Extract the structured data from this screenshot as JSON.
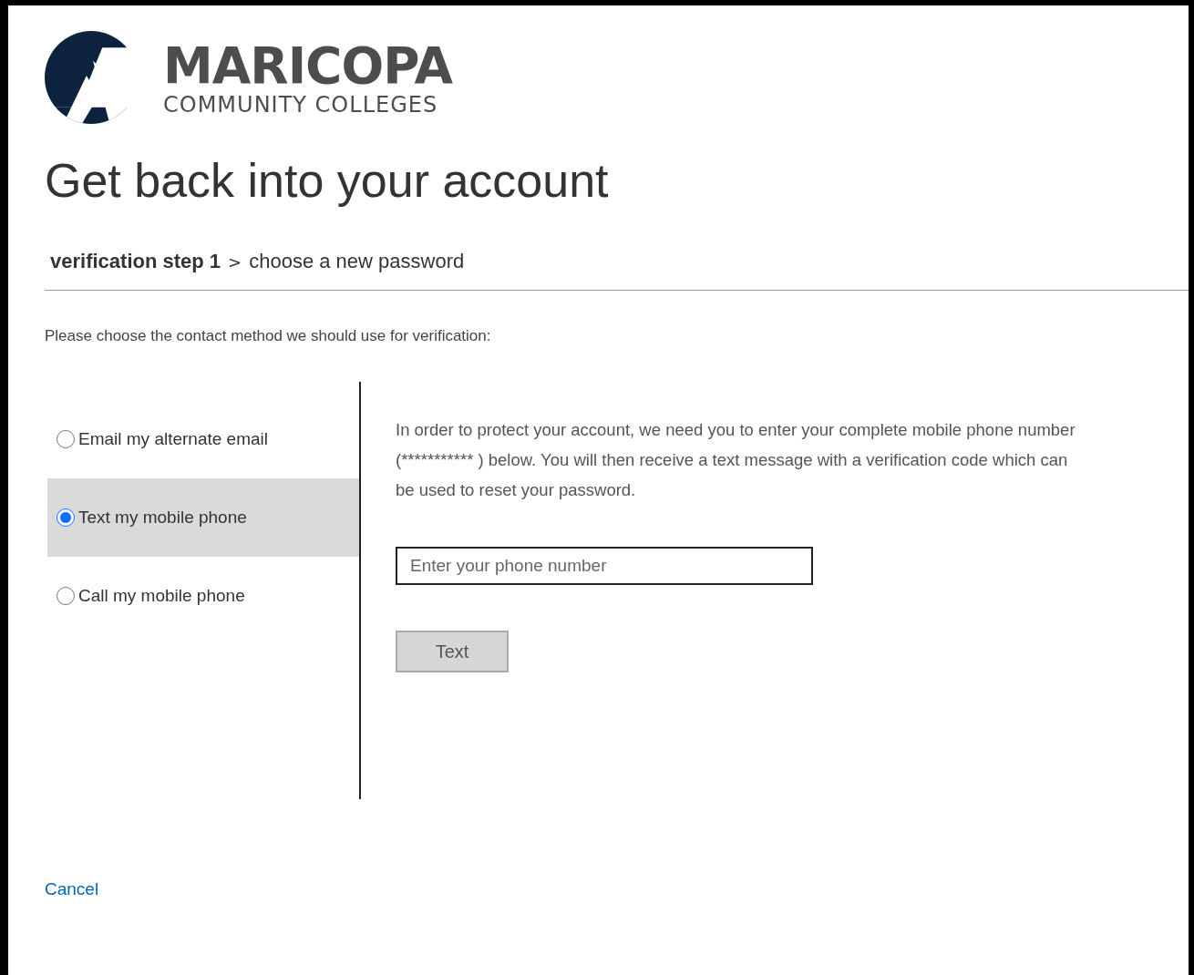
{
  "logo": {
    "name": "MARICOPA",
    "subtitle": "COMMUNITY COLLEGES"
  },
  "title": "Get back into your account",
  "steps": [
    {
      "label": "verification step 1",
      "selected": true
    },
    {
      "label": "choose a new password",
      "selected": false
    }
  ],
  "step_separator": ">",
  "instruction": "Please choose the contact method we should use for verification:",
  "methods": [
    {
      "label": "Email my alternate email",
      "selected": false
    },
    {
      "label": "Text my mobile phone",
      "selected": true
    },
    {
      "label": "Call my mobile phone",
      "selected": false
    }
  ],
  "description": "In order to protect your account, we need you to enter your complete mobile phone number (*********** ) below. You will then receive a text message with a verification code which can be used to reset your password.",
  "phone_field": {
    "placeholder": "Enter your phone number"
  },
  "submit_button": {
    "label": "Text",
    "disabled": true
  },
  "cancel_link": "Cancel"
}
